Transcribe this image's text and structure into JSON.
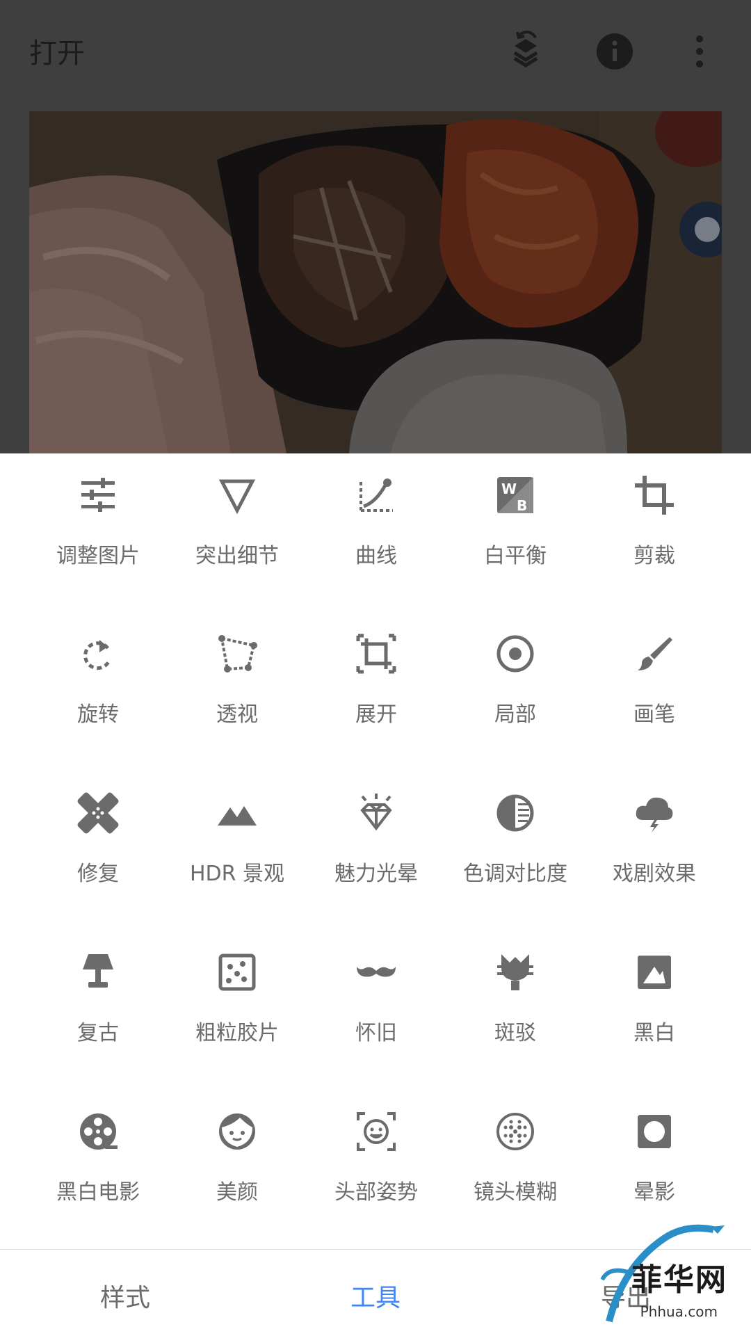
{
  "header": {
    "title": "打开",
    "icons": [
      "layers-restore-icon",
      "info-icon",
      "more-vert-icon"
    ]
  },
  "tools": [
    {
      "label": "调整图片",
      "icon": "tune-icon"
    },
    {
      "label": "突出细节",
      "icon": "details-icon"
    },
    {
      "label": "曲线",
      "icon": "curves-icon"
    },
    {
      "label": "白平衡",
      "icon": "white-balance-icon"
    },
    {
      "label": "剪裁",
      "icon": "crop-icon"
    },
    {
      "label": "旋转",
      "icon": "rotate-icon"
    },
    {
      "label": "透视",
      "icon": "perspective-icon"
    },
    {
      "label": "展开",
      "icon": "expand-icon"
    },
    {
      "label": "局部",
      "icon": "selective-icon"
    },
    {
      "label": "画笔",
      "icon": "brush-icon"
    },
    {
      "label": "修复",
      "icon": "healing-icon"
    },
    {
      "label": "HDR 景观",
      "icon": "hdr-landscape-icon"
    },
    {
      "label": "魅力光晕",
      "icon": "glamour-glow-icon"
    },
    {
      "label": "色调对比度",
      "icon": "tonal-contrast-icon"
    },
    {
      "label": "戏剧效果",
      "icon": "drama-icon"
    },
    {
      "label": "复古",
      "icon": "vintage-lamp-icon"
    },
    {
      "label": "粗粒胶片",
      "icon": "grainy-film-icon"
    },
    {
      "label": "怀旧",
      "icon": "retrolux-mustache-icon"
    },
    {
      "label": "斑驳",
      "icon": "grunge-icon"
    },
    {
      "label": "黑白",
      "icon": "black-white-icon"
    },
    {
      "label": "黑白电影",
      "icon": "noir-film-reel-icon"
    },
    {
      "label": "美颜",
      "icon": "portrait-face-icon"
    },
    {
      "label": "头部姿势",
      "icon": "head-pose-icon"
    },
    {
      "label": "镜头模糊",
      "icon": "lens-blur-icon"
    },
    {
      "label": "晕影",
      "icon": "vignette-icon"
    }
  ],
  "nav": {
    "styles": "样式",
    "tools": "工具",
    "export": "导出",
    "active": "tools"
  },
  "watermark": {
    "text": "菲华网",
    "sub": "Phhua.com"
  },
  "colors": {
    "icon": "#6b6b6b",
    "active": "#4285f4",
    "dim": "#3f3f3f"
  }
}
